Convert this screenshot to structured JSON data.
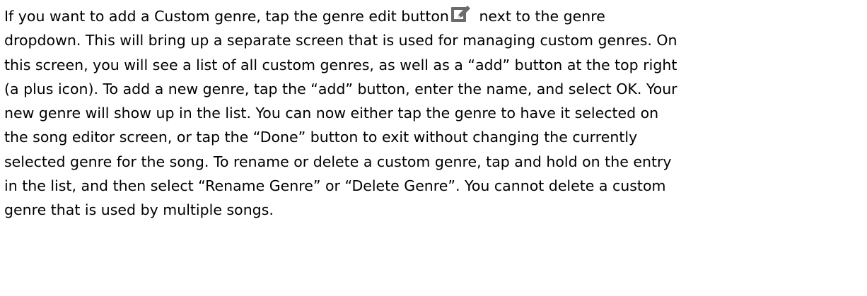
{
  "paragraph": {
    "line1_before": "If you want to add a Custom genre, tap the genre edit button",
    "line1_after": " next to the genre",
    "line2": "dropdown. This will bring up a separate screen that is used for managing custom genres. On",
    "line3": "this screen, you will see a list of all custom genres, as well as a “add” button at the top right",
    "line4": "(a plus icon). To add a new genre, tap the “add” button, enter the name, and select OK. Your",
    "line5": "new genre will show up in the list. You can now either tap the genre to have it selected on",
    "line6": "the song editor screen, or tap the “Done” button to exit without changing the currently",
    "line7": "selected genre for the song. To rename or delete a custom genre, tap and hold on the entry",
    "line8": "in the list, and then select “Rename Genre” or “Delete Genre”.  You cannot delete a custom",
    "line9": "genre that is used by multiple songs."
  },
  "icons": {
    "genre_edit": "edit-pencil-icon"
  },
  "colors": {
    "text": "#000000",
    "icon": "#6b6b6b"
  }
}
